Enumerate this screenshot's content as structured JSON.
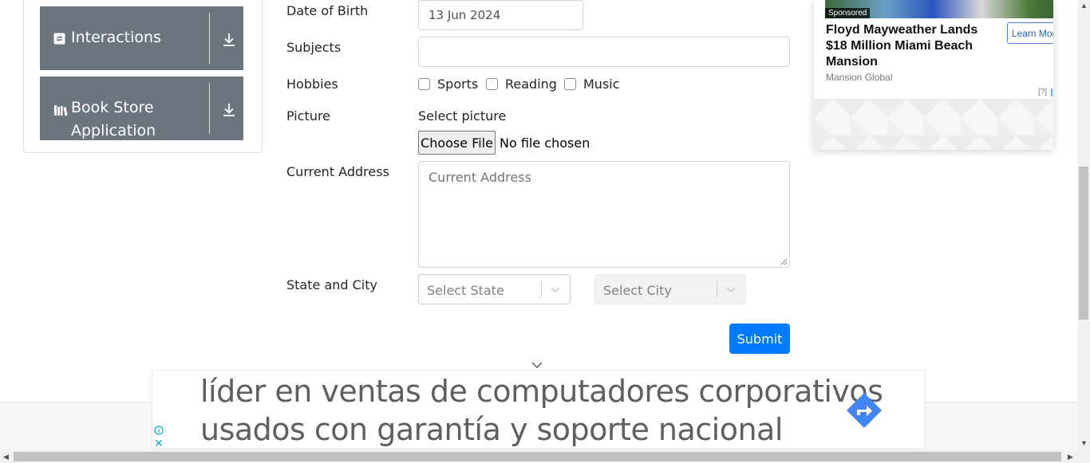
{
  "sidebar": {
    "groups": [
      {
        "label": "Interactions",
        "icon": "refresh-icon"
      },
      {
        "label": "Book Store Application",
        "label_line1": "Book Store",
        "label_line2": "Application",
        "icon": "books-icon"
      }
    ]
  },
  "form": {
    "dob": {
      "label": "Date of Birth",
      "value": "13 Jun 2024"
    },
    "subjects": {
      "label": "Subjects",
      "value": ""
    },
    "hobbies": {
      "label": "Hobbies",
      "options": [
        {
          "label": "Sports",
          "checked": false
        },
        {
          "label": "Reading",
          "checked": false
        },
        {
          "label": "Music",
          "checked": false
        }
      ]
    },
    "picture": {
      "label": "Picture",
      "prompt": "Select picture",
      "button": "Choose File",
      "status": "No file chosen"
    },
    "address": {
      "label": "Current Address",
      "placeholder": "Current Address"
    },
    "state_city": {
      "label": "State and City",
      "state_placeholder": "Select State",
      "city_placeholder": "Select City"
    },
    "submit": "Submit"
  },
  "side_ad": {
    "badge": "Sponsored",
    "title": "Floyd Mayweather Lands $18 Million Miami Beach Mansion",
    "cta": "Learn More",
    "source": "Mansion Global",
    "help": "[?]"
  },
  "bottom_ad": {
    "line1": "líder en ventas de computadores corporativos",
    "line2": "usados con garantía y soporte nacional"
  },
  "colors": {
    "primary": "#007bff",
    "sidebar_group": "#6c757d",
    "ad_accent": "#00aecd",
    "ad_arrow": "#4285f4"
  }
}
